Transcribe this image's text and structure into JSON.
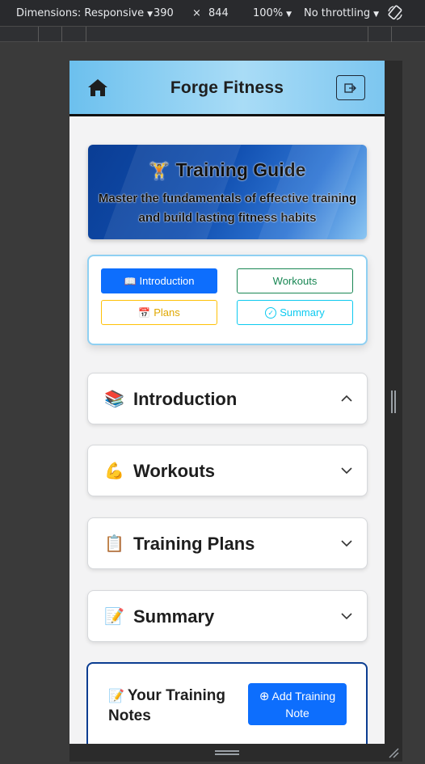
{
  "devtools": {
    "dimensions_label": "Dimensions: Responsive",
    "width": "390",
    "times": "×",
    "height": "844",
    "zoom": "100%",
    "throttling": "No throttling"
  },
  "header": {
    "brand": "Forge Fitness",
    "home_icon": "home-icon",
    "logout_icon": "logout-icon"
  },
  "hero": {
    "emoji": "🏋️",
    "title": "Training Guide",
    "subtitle": "Master the fundamentals of effective training and build lasting fitness habits"
  },
  "nav": {
    "introduction": {
      "icon": "📖",
      "label": "Introduction"
    },
    "workouts": {
      "label": "Workouts"
    },
    "plans": {
      "icon": "📅",
      "label": "Plans"
    },
    "summary": {
      "icon": "✓",
      "label": "Summary"
    }
  },
  "sections": [
    {
      "emoji": "📚",
      "label": "Introduction",
      "expanded": true
    },
    {
      "emoji": "💪",
      "label": "Workouts",
      "expanded": false
    },
    {
      "emoji": "📋",
      "label": "Training Plans",
      "expanded": false
    },
    {
      "emoji": "📝",
      "label": "Summary",
      "expanded": false
    }
  ],
  "notes": {
    "emoji": "📝",
    "title": "Your Training Notes",
    "add_icon": "⊕",
    "add_label": "Add Training Note"
  },
  "colors": {
    "primary": "#0d6efd",
    "success": "#198754",
    "warning": "#ffc107",
    "info": "#0dcaf0",
    "header_bg": "#6cc0ee",
    "hero_bg": "#0a3d94"
  }
}
